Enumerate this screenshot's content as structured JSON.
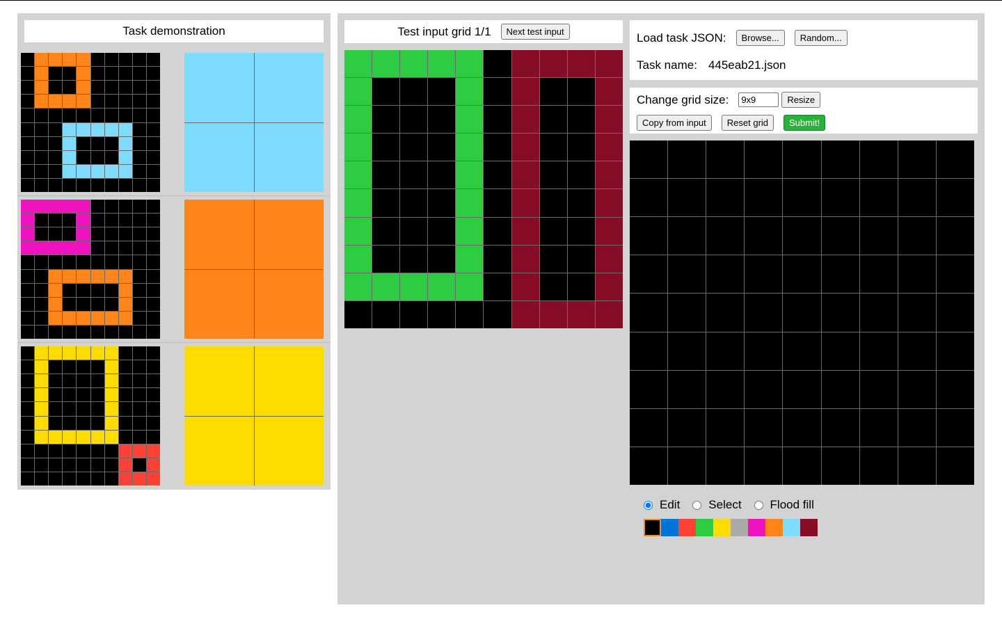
{
  "colors": [
    "#000000",
    "#0074D9",
    "#FF4136",
    "#2ECC40",
    "#FFDC00",
    "#AAAAAA",
    "#F012BE",
    "#FF851B",
    "#7FDBFF",
    "#870C25"
  ],
  "demo": {
    "title": "Task demonstration",
    "pairs": [
      {
        "input": [
          [
            0,
            7,
            7,
            7,
            7,
            0,
            0,
            0,
            0,
            0
          ],
          [
            0,
            7,
            0,
            0,
            7,
            0,
            0,
            0,
            0,
            0
          ],
          [
            0,
            7,
            0,
            0,
            7,
            0,
            0,
            0,
            0,
            0
          ],
          [
            0,
            7,
            7,
            7,
            7,
            0,
            0,
            0,
            0,
            0
          ],
          [
            0,
            0,
            0,
            0,
            0,
            0,
            0,
            0,
            0,
            0
          ],
          [
            0,
            0,
            0,
            8,
            8,
            8,
            8,
            8,
            0,
            0
          ],
          [
            0,
            0,
            0,
            8,
            0,
            0,
            0,
            8,
            0,
            0
          ],
          [
            0,
            0,
            0,
            8,
            0,
            0,
            0,
            8,
            0,
            0
          ],
          [
            0,
            0,
            0,
            8,
            8,
            8,
            8,
            8,
            0,
            0
          ],
          [
            0,
            0,
            0,
            0,
            0,
            0,
            0,
            0,
            0,
            0
          ]
        ],
        "output": [
          [
            8,
            8
          ],
          [
            8,
            8
          ]
        ]
      },
      {
        "input": [
          [
            6,
            6,
            6,
            6,
            6,
            0,
            0,
            0,
            0,
            0
          ],
          [
            6,
            0,
            0,
            0,
            6,
            0,
            0,
            0,
            0,
            0
          ],
          [
            6,
            0,
            0,
            0,
            6,
            0,
            0,
            0,
            0,
            0
          ],
          [
            6,
            6,
            6,
            6,
            6,
            0,
            0,
            0,
            0,
            0
          ],
          [
            0,
            0,
            0,
            0,
            0,
            0,
            0,
            0,
            0,
            0
          ],
          [
            0,
            0,
            7,
            7,
            7,
            7,
            7,
            7,
            0,
            0
          ],
          [
            0,
            0,
            7,
            0,
            0,
            0,
            0,
            7,
            0,
            0
          ],
          [
            0,
            0,
            7,
            0,
            0,
            0,
            0,
            7,
            0,
            0
          ],
          [
            0,
            0,
            7,
            7,
            7,
            7,
            7,
            7,
            0,
            0
          ],
          [
            0,
            0,
            0,
            0,
            0,
            0,
            0,
            0,
            0,
            0
          ]
        ],
        "output": [
          [
            7,
            7
          ],
          [
            7,
            7
          ]
        ]
      },
      {
        "input": [
          [
            0,
            4,
            4,
            4,
            4,
            4,
            4,
            0,
            0,
            0
          ],
          [
            0,
            4,
            0,
            0,
            0,
            0,
            4,
            0,
            0,
            0
          ],
          [
            0,
            4,
            0,
            0,
            0,
            0,
            4,
            0,
            0,
            0
          ],
          [
            0,
            4,
            0,
            0,
            0,
            0,
            4,
            0,
            0,
            0
          ],
          [
            0,
            4,
            0,
            0,
            0,
            0,
            4,
            0,
            0,
            0
          ],
          [
            0,
            4,
            0,
            0,
            0,
            0,
            4,
            0,
            0,
            0
          ],
          [
            0,
            4,
            4,
            4,
            4,
            4,
            4,
            0,
            0,
            0
          ],
          [
            0,
            0,
            0,
            0,
            0,
            0,
            0,
            2,
            2,
            2
          ],
          [
            0,
            0,
            0,
            0,
            0,
            0,
            0,
            2,
            0,
            2
          ],
          [
            0,
            0,
            0,
            0,
            0,
            0,
            0,
            2,
            2,
            2
          ]
        ],
        "output": [
          [
            4,
            4
          ],
          [
            4,
            4
          ]
        ]
      }
    ]
  },
  "test": {
    "header": "Test input grid 1/1",
    "next_label": "Next test input",
    "grid": [
      [
        3,
        3,
        3,
        3,
        3,
        0,
        9,
        9,
        9,
        9
      ],
      [
        3,
        0,
        0,
        0,
        3,
        0,
        9,
        0,
        0,
        9
      ],
      [
        3,
        0,
        0,
        0,
        3,
        0,
        9,
        0,
        0,
        9
      ],
      [
        3,
        0,
        0,
        0,
        3,
        0,
        9,
        0,
        0,
        9
      ],
      [
        3,
        0,
        0,
        0,
        3,
        0,
        9,
        0,
        0,
        9
      ],
      [
        3,
        0,
        0,
        0,
        3,
        0,
        9,
        0,
        0,
        9
      ],
      [
        3,
        0,
        0,
        0,
        3,
        0,
        9,
        0,
        0,
        9
      ],
      [
        3,
        0,
        0,
        0,
        3,
        0,
        9,
        0,
        0,
        9
      ],
      [
        3,
        3,
        3,
        3,
        3,
        0,
        9,
        0,
        0,
        9
      ],
      [
        0,
        0,
        0,
        0,
        0,
        0,
        9,
        9,
        9,
        9
      ]
    ]
  },
  "controls": {
    "load_label": "Load task JSON:",
    "browse_label": "Browse...",
    "random_label": "Random...",
    "task_name_label": "Task name:",
    "task_name_value": "445eab21.json",
    "grid_size_label": "Change grid size:",
    "grid_size_value": "9x9",
    "resize_label": "Resize",
    "copy_label": "Copy from input",
    "reset_label": "Reset grid",
    "submit_label": "Submit!"
  },
  "output_grid": {
    "rows": 9,
    "cols": 9,
    "fill": 0
  },
  "modes": {
    "items": [
      "Edit",
      "Select",
      "Flood fill"
    ],
    "selected": "Edit"
  },
  "palette": {
    "selected_index": 0
  }
}
